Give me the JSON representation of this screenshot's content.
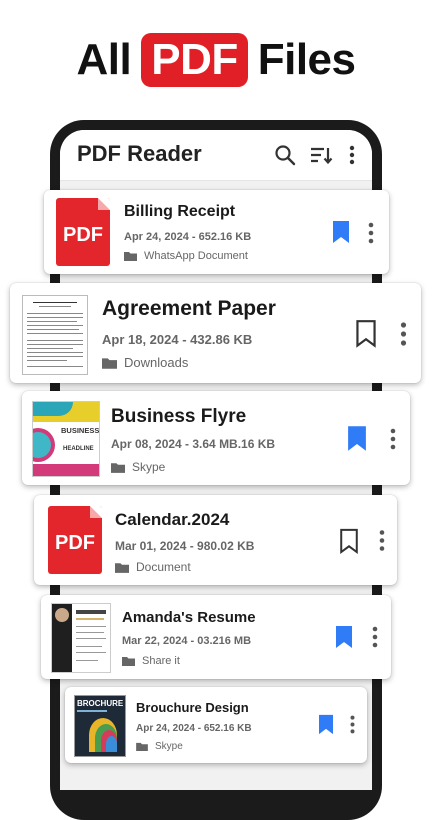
{
  "headline": {
    "prefix": "All",
    "badge": "PDF",
    "suffix": "Files"
  },
  "appbar": {
    "title": "PDF Reader",
    "icons": [
      "search-icon",
      "sort-icon",
      "more-vert-icon"
    ]
  },
  "colors": {
    "brand_red": "#e01f26",
    "bookmark_blue": "#2f7cf6",
    "bookmark_outline": "#333333",
    "phone_frame": "#1b1b1b"
  },
  "files": [
    {
      "name": "Billing Receipt",
      "meta": "Apr 24, 2024 - 652.16 KB",
      "folder": "WhatsApp Document",
      "thumbnail": "pdf-icon",
      "bookmarked": true
    },
    {
      "name": "Agreement Paper",
      "meta": "Apr 18, 2024 - 432.86 KB",
      "folder": "Downloads",
      "thumbnail": "document-preview",
      "bookmarked": false
    },
    {
      "name": "Business Flyre",
      "meta": "Apr 08, 2024 - 3.64 MB.16 KB",
      "folder": "Skype",
      "thumbnail": "flyer-preview",
      "bookmarked": true
    },
    {
      "name": "Calendar.2024",
      "meta": "Mar 01, 2024 - 980.02 KB",
      "folder": "Document",
      "thumbnail": "pdf-icon",
      "bookmarked": false
    },
    {
      "name": "Amanda's Resume",
      "meta": "Mar 22, 2024 - 03.216 MB",
      "folder": "Share it",
      "thumbnail": "resume-preview",
      "bookmarked": true
    },
    {
      "name": "Brouchure Design",
      "meta": "Apr 24, 2024 - 652.16 KB",
      "folder": "Skype",
      "thumbnail": "brochure-preview",
      "bookmarked": true
    }
  ],
  "thumb_text": {
    "pdf_label": "PDF",
    "flyer_title": "BUSINESS",
    "flyer_sub": "HEADLINE",
    "brochure_title": "BROCHURE"
  }
}
